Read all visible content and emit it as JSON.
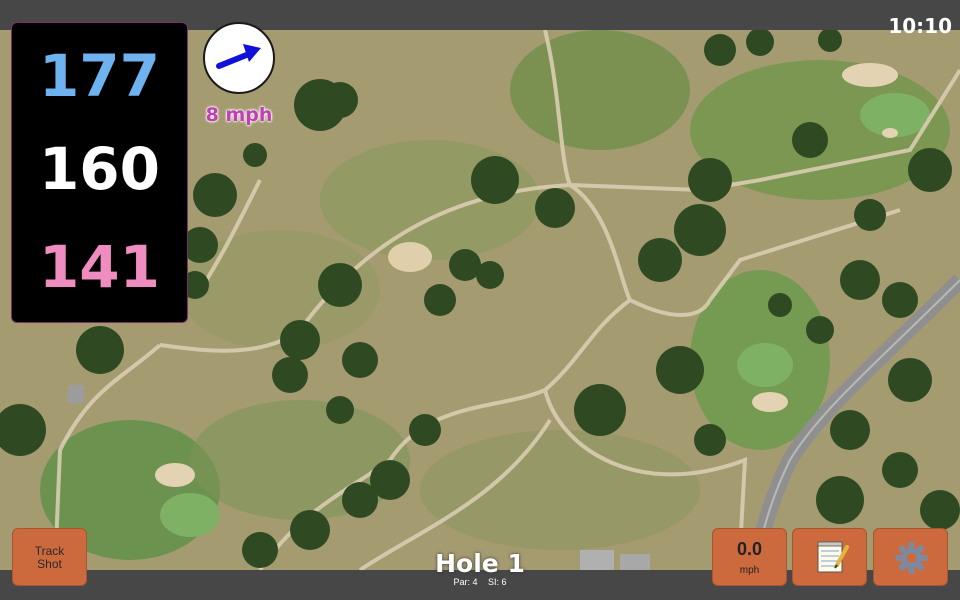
{
  "status": {
    "time": "10:10"
  },
  "distances": {
    "back": "177",
    "middle": "160",
    "front": "141"
  },
  "wind": {
    "speed_label": "8 mph",
    "direction_icon": "arrow-right-icon",
    "arrow_color": "#1010d8"
  },
  "hole": {
    "title": "Hole 1",
    "par": "Par: 4",
    "stroke_index": "SI: 6"
  },
  "buttons": {
    "track_shot": "Track\nShot",
    "wind_value": "0.0",
    "wind_unit": "mph",
    "notes_icon": "notepad-icon",
    "settings_icon": "gear-icon"
  },
  "colors": {
    "button": "#cc6a3e",
    "back": "#6fb2f0",
    "middle": "#ffffff",
    "front": "#f08dc0",
    "wind_text": "#c03fb4"
  }
}
